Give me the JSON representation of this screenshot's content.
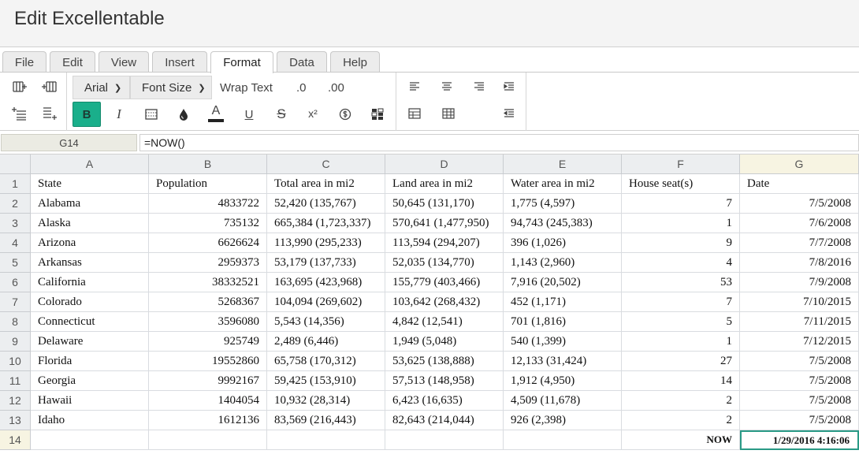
{
  "app": {
    "title": "Edit Excellentable"
  },
  "menu_tabs": [
    {
      "label": "File",
      "active": false
    },
    {
      "label": "Edit",
      "active": false
    },
    {
      "label": "View",
      "active": false
    },
    {
      "label": "Insert",
      "active": false
    },
    {
      "label": "Format",
      "active": true
    },
    {
      "label": "Data",
      "active": false
    },
    {
      "label": "Help",
      "active": false
    }
  ],
  "toolbar": {
    "font_family": "Arial",
    "font_size": "Font Size",
    "wrap_text": "Wrap Text",
    "decrease_decimals": ".0",
    "increase_decimals": ".00",
    "bold": "B",
    "italic": "I",
    "underline": "U",
    "strikethrough": "S",
    "superscript": "x²",
    "font_color": "A",
    "font_color_value": "#222222",
    "bold_active_color": "#1aaf8b"
  },
  "formula_bar": {
    "cell_ref": "G14",
    "formula": "=NOW()"
  },
  "sheet": {
    "selected_column": "G",
    "selected_row": "14",
    "columns": [
      "A",
      "B",
      "C",
      "D",
      "E",
      "F",
      "G"
    ],
    "rows": [
      {
        "num": "1",
        "cells": [
          "State",
          "Population",
          "Total area in mi2",
          "Land area in mi2",
          "Water area in mi2",
          "House seat(s)",
          "Date"
        ]
      },
      {
        "num": "2",
        "cells": [
          "Alabama",
          "4833722",
          "52,420 (135,767)",
          "50,645 (131,170)",
          "1,775 (4,597)",
          "7",
          "7/5/2008"
        ]
      },
      {
        "num": "3",
        "cells": [
          "Alaska",
          "735132",
          "665,384 (1,723,337)",
          "570,641 (1,477,950)",
          "94,743 (245,383)",
          "1",
          "7/6/2008"
        ]
      },
      {
        "num": "4",
        "cells": [
          "Arizona",
          "6626624",
          "113,990 (295,233)",
          "113,594 (294,207)",
          "396 (1,026)",
          "9",
          "7/7/2008"
        ]
      },
      {
        "num": "5",
        "cells": [
          "Arkansas",
          "2959373",
          "53,179 (137,733)",
          "52,035 (134,770)",
          "1,143 (2,960)",
          "4",
          "7/8/2016"
        ]
      },
      {
        "num": "6",
        "cells": [
          "California",
          "38332521",
          "163,695 (423,968)",
          "155,779 (403,466)",
          "7,916 (20,502)",
          "53",
          "7/9/2008"
        ]
      },
      {
        "num": "7",
        "cells": [
          "Colorado",
          "5268367",
          "104,094 (269,602)",
          "103,642 (268,432)",
          "452 (1,171)",
          "7",
          "7/10/2015"
        ]
      },
      {
        "num": "8",
        "cells": [
          "Connecticut",
          "3596080",
          "5,543 (14,356)",
          "4,842 (12,541)",
          "701 (1,816)",
          "5",
          "7/11/2015"
        ]
      },
      {
        "num": "9",
        "cells": [
          "Delaware",
          "925749",
          "2,489 (6,446)",
          "1,949 (5,048)",
          "540 (1,399)",
          "1",
          "7/12/2015"
        ]
      },
      {
        "num": "10",
        "cells": [
          "Florida",
          "19552860",
          "65,758 (170,312)",
          "53,625 (138,888)",
          "12,133 (31,424)",
          "27",
          "7/5/2008"
        ]
      },
      {
        "num": "11",
        "cells": [
          "Georgia",
          "9992167",
          "59,425 (153,910)",
          "57,513 (148,958)",
          "1,912 (4,950)",
          "14",
          "7/5/2008"
        ]
      },
      {
        "num": "12",
        "cells": [
          "Hawaii",
          "1404054",
          "10,932 (28,314)",
          "6,423 (16,635)",
          "4,509 (11,678)",
          "2",
          "7/5/2008"
        ]
      },
      {
        "num": "13",
        "cells": [
          "Idaho",
          "1612136",
          "83,569 (216,443)",
          "82,643 (214,044)",
          "926 (2,398)",
          "2",
          "7/5/2008"
        ]
      },
      {
        "num": "14",
        "cells": [
          "",
          "",
          "",
          "",
          "",
          "NOW",
          "1/29/2016 4:16:06"
        ]
      }
    ]
  }
}
